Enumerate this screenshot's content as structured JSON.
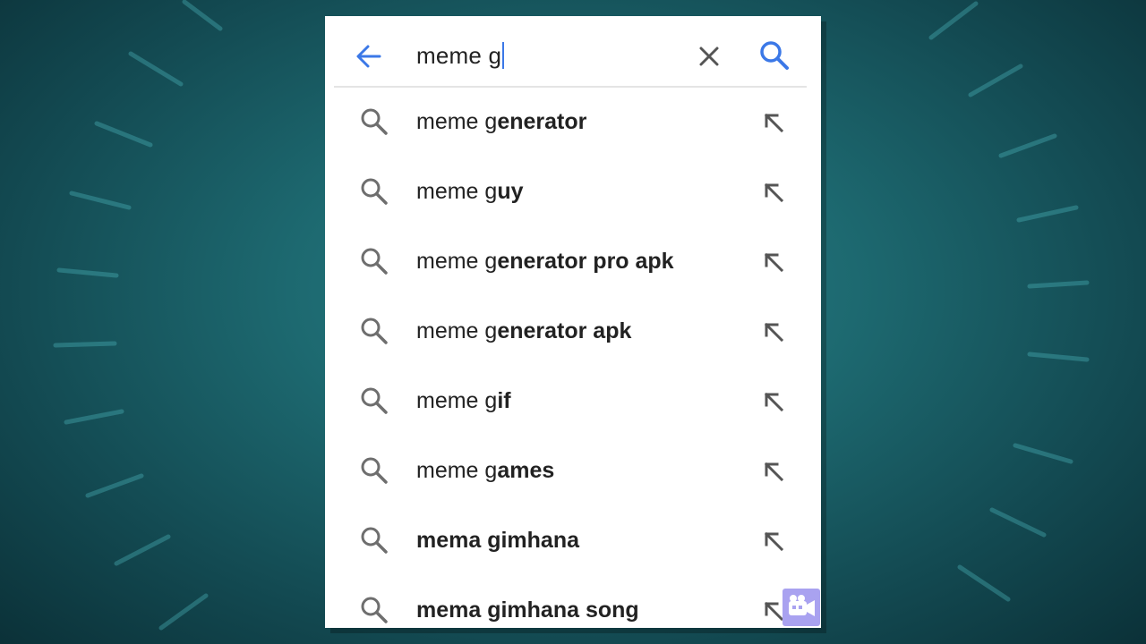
{
  "search": {
    "query": "meme g",
    "back_icon": "arrow-left-icon",
    "clear_icon": "close-icon",
    "submit_icon": "search-icon",
    "accent_color": "#3b78e7"
  },
  "suggestions": [
    {
      "typed": "meme g",
      "completion": "enerator"
    },
    {
      "typed": "meme g",
      "completion": "uy"
    },
    {
      "typed": "meme g",
      "completion": "enerator pro apk"
    },
    {
      "typed": "meme g",
      "completion": "enerator apk"
    },
    {
      "typed": "meme g",
      "completion": "if"
    },
    {
      "typed": "meme g",
      "completion": "ames"
    },
    {
      "typed": "",
      "completion": "mema gimhana"
    },
    {
      "typed": "",
      "completion": "mema gimhana song"
    }
  ],
  "suggestion_icon": "search-icon",
  "fill_icon": "arrow-up-left-icon",
  "overlay_icon": "video-camera-icon"
}
